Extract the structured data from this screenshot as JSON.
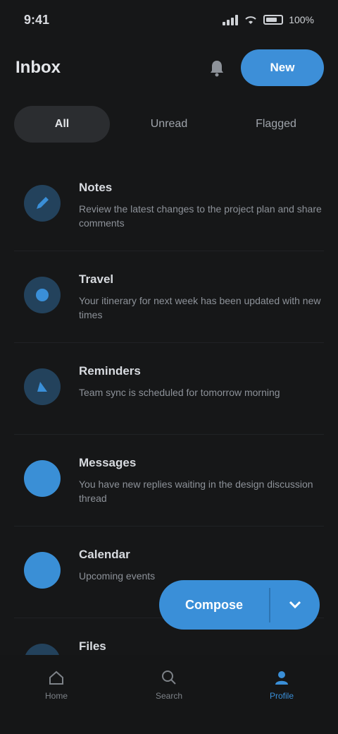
{
  "status": {
    "time": "9:41",
    "battery": "100%"
  },
  "header": {
    "title": "Inbox",
    "action_label": "New"
  },
  "tabs": [
    {
      "label": "All",
      "active": true
    },
    {
      "label": "Unread",
      "active": false
    },
    {
      "label": "Flagged",
      "active": false
    }
  ],
  "items": [
    {
      "icon": "pen-icon",
      "title": "Notes",
      "text": "Review the latest changes to the project plan and share comments",
      "solid": false
    },
    {
      "icon": "globe-icon",
      "title": "Travel",
      "text": "Your itinerary for next week has been updated with new times",
      "solid": false
    },
    {
      "icon": "bell-icon",
      "title": "Reminders",
      "text": "Team sync is scheduled for tomorrow morning",
      "solid": false
    },
    {
      "icon": "chat-icon",
      "title": "Messages",
      "text": "You have new replies waiting in the design discussion thread",
      "solid": true
    },
    {
      "icon": "calendar-icon",
      "title": "Calendar",
      "text": "Upcoming events",
      "solid": true
    },
    {
      "icon": "folder-icon",
      "title": "Files",
      "text": "",
      "solid": false
    }
  ],
  "fab": {
    "label": "Compose"
  },
  "nav": [
    {
      "icon": "home-icon",
      "label": "Home",
      "active": false
    },
    {
      "icon": "search-icon",
      "label": "Search",
      "active": false
    },
    {
      "icon": "person-icon",
      "label": "Profile",
      "active": true
    }
  ],
  "colors": {
    "accent": "#3a8fd8",
    "background": "#161718"
  }
}
